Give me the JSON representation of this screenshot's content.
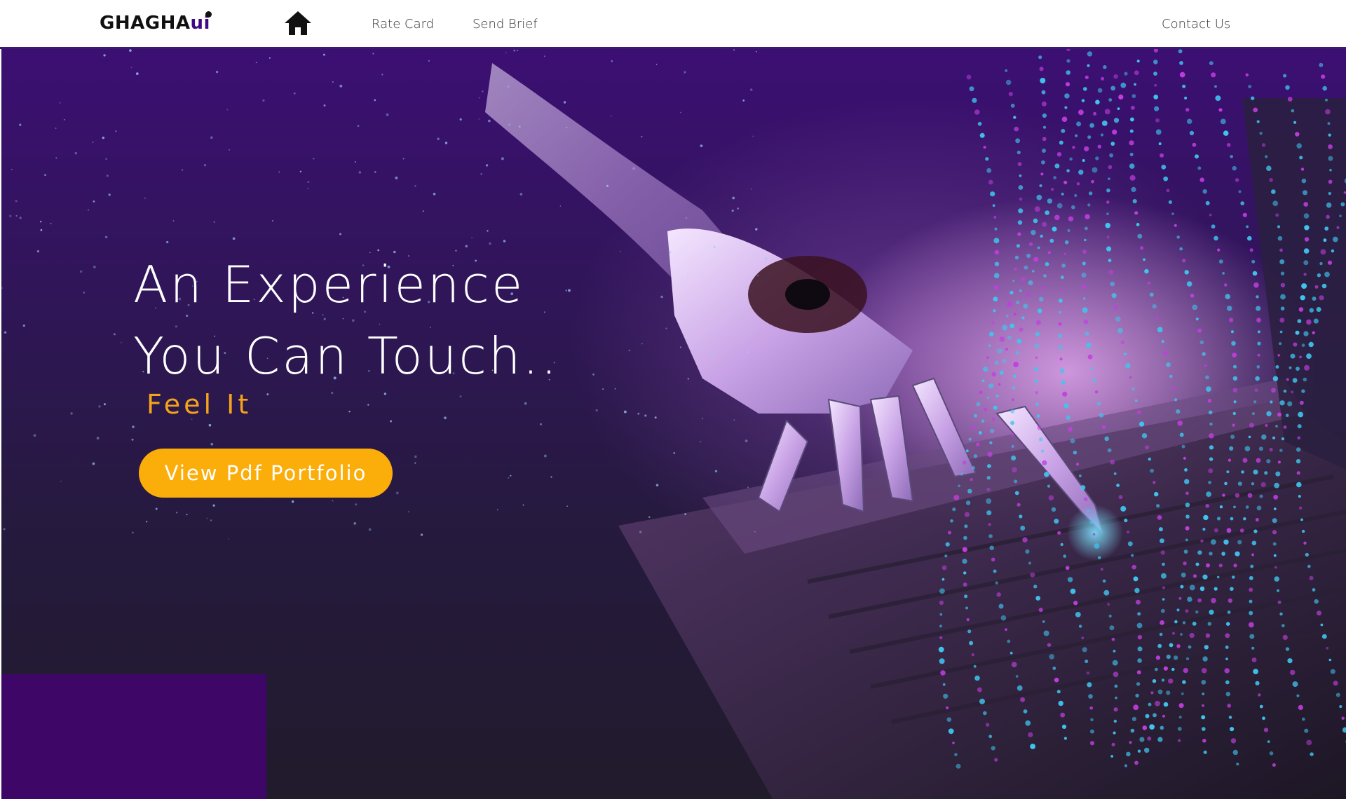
{
  "nav": {
    "logo_text": "GHAGHA",
    "logo_accent": "ui",
    "home_icon": "home-icon",
    "rate_card": "Rate Card",
    "send_brief": "Send Brief",
    "contact_us": "Contact Us"
  },
  "hero": {
    "headline_line1": "An Experience",
    "headline_line2": "You Can Touch..",
    "tagline": "Feel It",
    "cta_label": "View Pdf Portfolio",
    "image": "robot-hand-touching-laptop"
  },
  "colors": {
    "nav_bg": "#ffffff",
    "logo_accent": "#3f0a86",
    "hero_dark": "#211b2c",
    "hero_purple": "#3c0f73",
    "tagline": "#f5a31a",
    "cta_bg": "#fbad0a",
    "block": "#3e0767"
  }
}
